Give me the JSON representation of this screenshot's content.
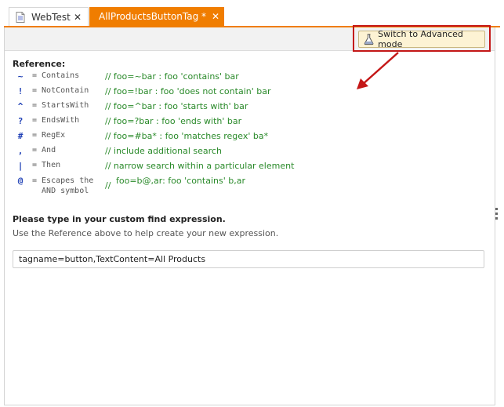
{
  "tabs": [
    {
      "label": "WebTest",
      "icon": "document-icon",
      "close": "✕"
    },
    {
      "label": "AllProductsButtonTag",
      "modified_marker": "*",
      "icon": "atom-icon",
      "close": "✕"
    }
  ],
  "toolbar": {
    "advanced_button_label": "Switch to Advanced mode",
    "advanced_button_icon": "flask-icon"
  },
  "reference": {
    "title": "Reference:",
    "rows": [
      {
        "symbol": "~",
        "name": "= Contains",
        "comment": "// foo=~bar : foo 'contains' bar"
      },
      {
        "symbol": "!",
        "name": "= NotContain",
        "comment": "// foo=!bar : foo 'does not contain' bar"
      },
      {
        "symbol": "^",
        "name": "= StartsWith",
        "comment": "// foo=^bar : foo 'starts with' bar"
      },
      {
        "symbol": "?",
        "name": "= EndsWith",
        "comment": "// foo=?bar : foo 'ends with' bar"
      },
      {
        "symbol": "#",
        "name": "= RegEx",
        "comment": "// foo=#ba* : foo 'matches regex' ba*"
      },
      {
        "symbol": ",",
        "name": "= And",
        "comment": "// include additional search"
      },
      {
        "symbol": "|",
        "name": "= Then",
        "comment": "// narrow search within a particular element"
      },
      {
        "symbol": "@",
        "name": "= Escapes the\n  AND symbol",
        "comment_prefix": "//",
        "comment": "foo=b@,ar: foo 'contains' b,ar"
      }
    ]
  },
  "expression": {
    "prompt": "Please type in your custom find expression.",
    "help": "Use the Reference above to help create your new expression.",
    "value": "tagname=button,TextContent=All Products"
  },
  "colors": {
    "accent": "#f07d00",
    "symbol": "#1e3fb5",
    "comment": "#2a8a2a",
    "annotation": "#c41717"
  }
}
